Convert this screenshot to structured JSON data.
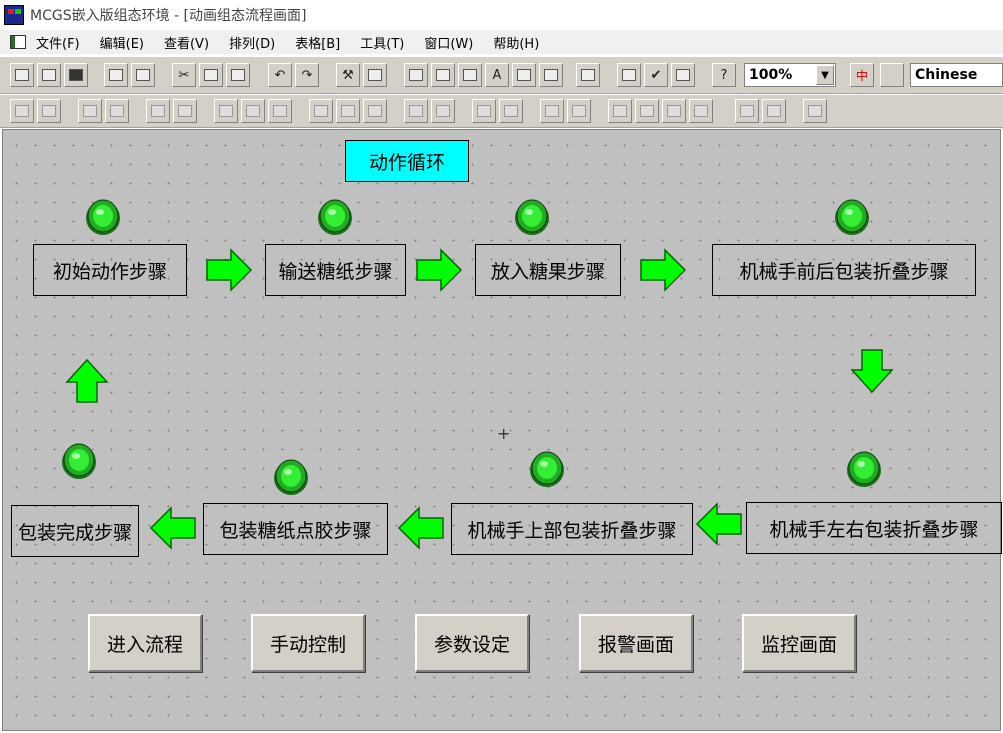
{
  "window": {
    "title": "MCGS嵌入版组态环境 - [动画组态流程画面]"
  },
  "menu": {
    "items": [
      "文件(F)",
      "编辑(E)",
      "查看(V)",
      "排列(D)",
      "表格[B]",
      "工具(T)",
      "窗口(W)",
      "帮助(H)"
    ]
  },
  "toolbar": {
    "zoom": "100%",
    "language": "Chinese"
  },
  "canvas": {
    "loop_label": "动作循环",
    "steps": {
      "initial": "初始动作步骤",
      "convey": "输送糖纸步骤",
      "place": "放入糖果步骤",
      "front_back": "机械手前后包装折叠步骤",
      "left_right": "机械手左右包装折叠步骤",
      "top": "机械手上部包装折叠步骤",
      "glue": "包装糖纸点胶步骤",
      "complete": "包装完成步骤"
    },
    "nav_buttons": [
      "进入流程",
      "手动控制",
      "参数设定",
      "报警画面",
      "监控画面"
    ]
  },
  "colors": {
    "arrow_green": "#00ff00",
    "lamp_green": "#22cc22",
    "label_cyan": "#00ffff",
    "canvas_gray": "#c0c0c0"
  }
}
